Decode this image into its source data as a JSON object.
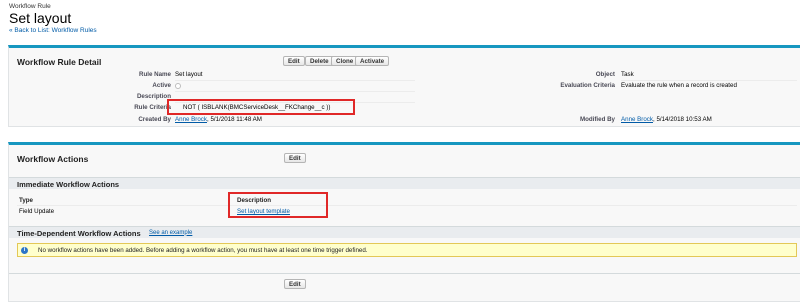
{
  "header": {
    "object_label": "Workflow Rule",
    "title": "Set layout",
    "back_link": "« Back to List: Workflow Rules"
  },
  "detail": {
    "section_title": "Workflow Rule Detail",
    "buttons": [
      "Edit",
      "Delete",
      "Clone",
      "Activate"
    ],
    "fields": {
      "rule_name_label": "Rule Name",
      "rule_name_value": "Set layout",
      "object_label": "Object",
      "object_value": "Task",
      "active_label": "Active",
      "evaluation_label": "Evaluation Criteria",
      "evaluation_value": "Evaluate the rule when a record is created",
      "description_label": "Description",
      "rule_criteria_label": "Rule Criteria",
      "rule_criteria_value": "NOT ( ISBLANK(BMCServiceDesk__FKChange__c ))",
      "created_by_label": "Created By",
      "created_by_name": "Anne Brock",
      "created_by_date": ", 5/1/2018 11:48 AM",
      "modified_by_label": "Modified By",
      "modified_by_name": "Anne Brock",
      "modified_by_date": ", 5/14/2018 10:53 AM"
    }
  },
  "actions": {
    "section_title": "Workflow Actions",
    "edit_label": "Edit",
    "immediate": {
      "title": "Immediate Workflow Actions",
      "col_type": "Type",
      "col_description": "Description",
      "rows": [
        {
          "type": "Field Update",
          "description": "Set layout template"
        }
      ]
    },
    "time_dependent": {
      "title": "Time-Dependent Workflow Actions",
      "example_link": "See an example",
      "info_icon": "info-icon",
      "message": "No workflow actions have been added. Before adding a workflow action, you must have at least one time trigger defined."
    },
    "bottom_edit_label": "Edit"
  },
  "colors": {
    "accent_border": "#1797c0",
    "link": "#015ba7",
    "highlight_box": "#e02828",
    "info_bg": "#ffffcc"
  }
}
